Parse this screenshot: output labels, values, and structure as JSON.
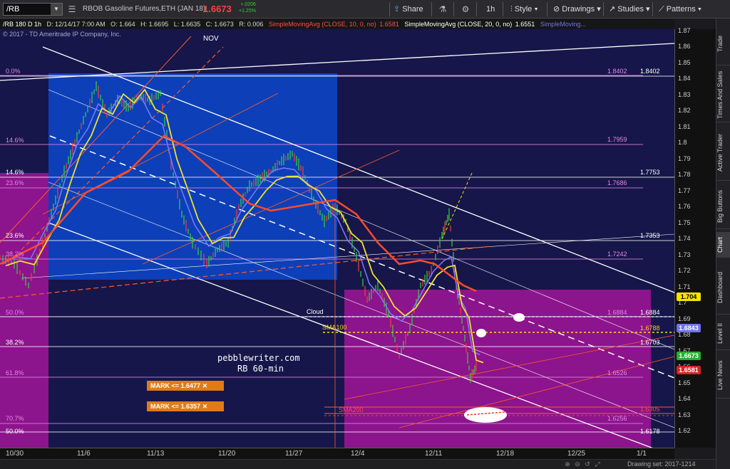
{
  "toolbar": {
    "symbol": "/RB",
    "description": "RBOB Gasoline Futures,ETH (JAN 18)",
    "last": "1.6673",
    "change": "+.0206",
    "change_pct": "+1.25%",
    "buttons": {
      "share": "Share",
      "interval": "1h",
      "style": "Style",
      "drawings": "Drawings",
      "studies": "Studies",
      "patterns": "Patterns"
    }
  },
  "inforow": {
    "symbol_period": "/RB 180 D 1h",
    "date": "D: 12/14/17 7:00 AM",
    "open": "O: 1.664",
    "high": "H: 1.6695",
    "low": "L: 1.6635",
    "close": "C: 1.6673",
    "range": "R: 0.006",
    "sma10": "SimpleMovingAvg (CLOSE, 10, 0, no)",
    "sma10_val": "1.6581",
    "sma20": "SimpleMovingAvg (CLOSE, 20, 0, no)",
    "sma20_val": "1.6551",
    "sma_more": "SimpleMoving..."
  },
  "chart": {
    "copyright": "© 2017 - TD Ameritrade IP Company, Inc.",
    "nov_label": "NOV",
    "watermark_site": "pebblewriter.com",
    "watermark_tf": "RB 60-min",
    "cloud_label": "Cloud",
    "sma100_label": "SMA100",
    "sma200_label": "SMA200",
    "mark1": "MARK <= 1.6477",
    "mark2": "MARK <= 1.6357",
    "fib_left": [
      {
        "text": "0.0%",
        "color": "#e28ae8"
      },
      {
        "text": "14.6%",
        "color": "#e28ae8"
      },
      {
        "text": "14.6%",
        "color": "#ffffff"
      },
      {
        "text": "23.6%",
        "color": "#e28ae8"
      },
      {
        "text": "23.6%",
        "color": "#ffffff"
      },
      {
        "text": "38.2%",
        "color": "#e28ae8"
      },
      {
        "text": "50.0%",
        "color": "#e28ae8"
      },
      {
        "text": "38.2%",
        "color": "#ffffff"
      },
      {
        "text": "61.8%",
        "color": "#e28ae8"
      },
      {
        "text": "70.7%",
        "color": "#e28ae8"
      },
      {
        "text": "50.0%",
        "color": "#ffffff"
      }
    ],
    "fib_right": [
      {
        "text": "1.8402",
        "color": "#e28ae8"
      },
      {
        "text": "1.8402",
        "color": "#ffffff"
      },
      {
        "text": "1.7959",
        "color": "#e28ae8"
      },
      {
        "text": "1.7753",
        "color": "#ffffff"
      },
      {
        "text": "1.7686",
        "color": "#e28ae8"
      },
      {
        "text": "1.7353",
        "color": "#ffffff"
      },
      {
        "text": "1.7242",
        "color": "#e28ae8"
      },
      {
        "text": "1.6884",
        "color": "#e28ae8"
      },
      {
        "text": "1.6884",
        "color": "#ffffff"
      },
      {
        "text": "1.6788",
        "color": "#ffd21a"
      },
      {
        "text": "1.6703",
        "color": "#ffffff"
      },
      {
        "text": "1.6526",
        "color": "#e28ae8"
      },
      {
        "text": "1.6305",
        "color": "#ff4a4a"
      },
      {
        "text": "1.6256",
        "color": "#e28ae8"
      },
      {
        "text": "1.6178",
        "color": "#ffffff"
      }
    ]
  },
  "yaxis": {
    "ticks": [
      "1.87",
      "1.86",
      "1.85",
      "1.84",
      "1.83",
      "1.82",
      "1.81",
      "1.8",
      "1.79",
      "1.78",
      "1.77",
      "1.76",
      "1.75",
      "1.74",
      "1.73",
      "1.72",
      "1.71",
      "1.7",
      "1.69",
      "1.68",
      "1.67",
      "1.66",
      "1.65",
      "1.64",
      "1.63",
      "1.62"
    ],
    "badges": [
      {
        "text": "1.704",
        "bg": "#f5e400",
        "fg": "#000000"
      },
      {
        "text": "1.6843",
        "bg": "#6f74e6",
        "fg": "#ffffff"
      },
      {
        "text": "1.6673",
        "bg": "#27b030",
        "fg": "#ffffff"
      },
      {
        "text": "1.6581",
        "bg": "#d42424",
        "fg": "#ffffff"
      }
    ]
  },
  "xaxis": {
    "ticks": [
      "10/30",
      "11/6",
      "11/13",
      "11/20",
      "11/27",
      "12/4",
      "12/11",
      "12/18",
      "12/25",
      "1/1"
    ]
  },
  "sidebar": {
    "tabs": [
      "Trade",
      "Times And Sales",
      "Active Trader",
      "Big Buttons",
      "Chart",
      "Dashboard",
      "Level II",
      "Live News"
    ],
    "active": "Chart"
  },
  "bottombar": {
    "drawing_set": "Drawing set: 2017-1214"
  },
  "icons": [
    "menu-icon",
    "link-icon",
    "flask-icon",
    "gear-icon",
    "share-icon",
    "style-icon",
    "drawings-icon",
    "studies-icon",
    "patterns-icon"
  ]
}
